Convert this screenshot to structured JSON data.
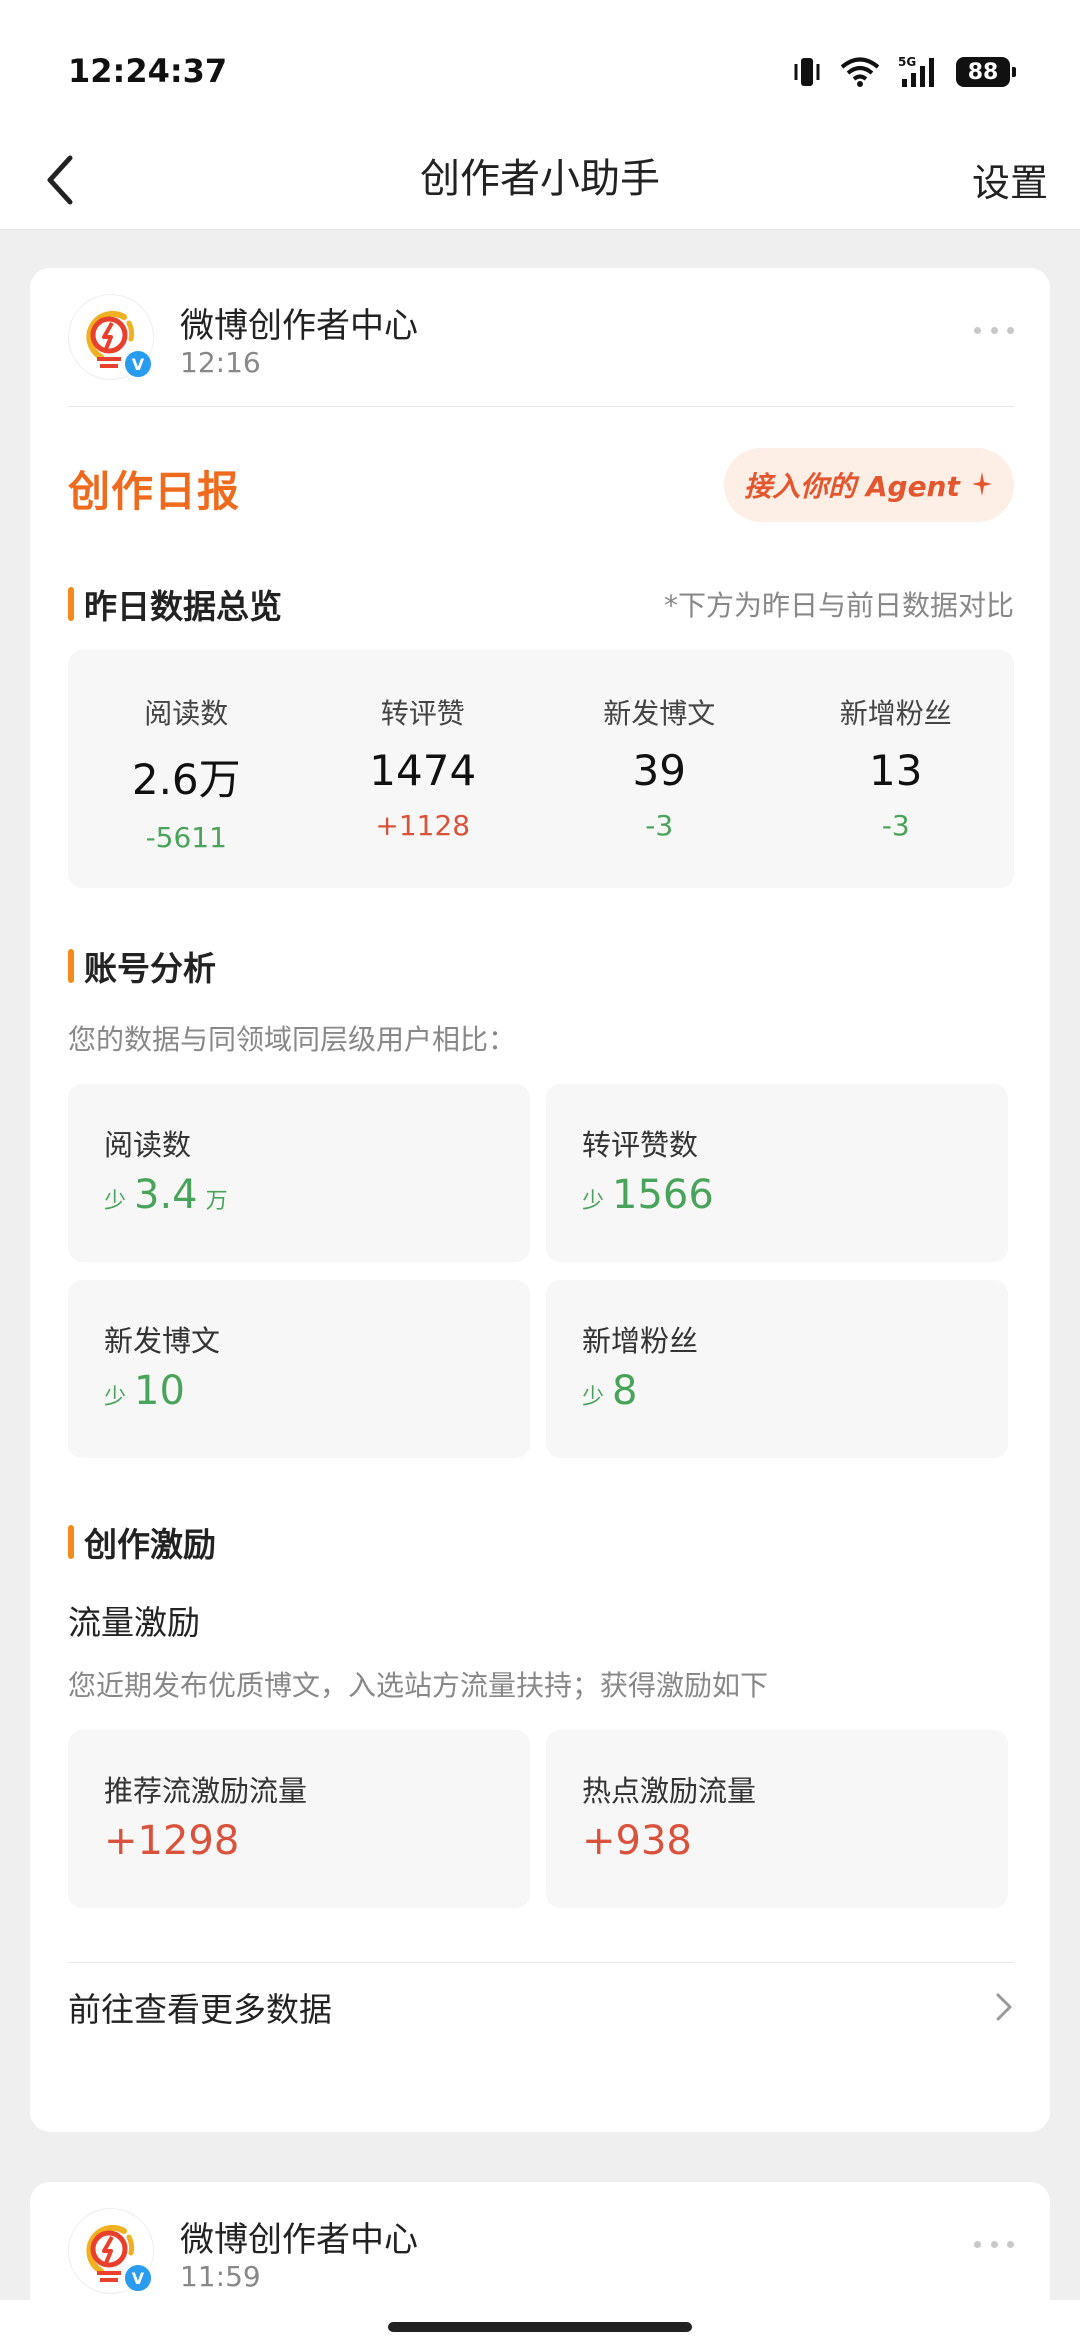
{
  "status_bar": {
    "time": "12:24:37",
    "battery": "88",
    "network": "5G"
  },
  "nav": {
    "title": "创作者小助手",
    "settings": "设置"
  },
  "message": {
    "sender": "微博创作者中心",
    "time": "12:16",
    "badge": "V",
    "report_title": "创作日报",
    "agent_button": "接入你的 Agent",
    "overview": {
      "title": "昨日数据总览",
      "note": "*下方为昨日与前日数据对比",
      "stats": [
        {
          "label": "阅读数",
          "value": "2.6万",
          "delta": "-5611",
          "trend": "down"
        },
        {
          "label": "转评赞",
          "value": "1474",
          "delta": "+1128",
          "trend": "up"
        },
        {
          "label": "新发博文",
          "value": "39",
          "delta": "-3",
          "trend": "down"
        },
        {
          "label": "新增粉丝",
          "value": "13",
          "delta": "-3",
          "trend": "down"
        }
      ]
    },
    "analysis": {
      "title": "账号分析",
      "intro": "您的数据与同领域同层级用户相比：",
      "metrics": [
        {
          "label": "阅读数",
          "prefix": "少",
          "value": "3.4",
          "unit": "万"
        },
        {
          "label": "转评赞数",
          "prefix": "少",
          "value": "1566",
          "unit": ""
        },
        {
          "label": "新发博文",
          "prefix": "少",
          "value": "10",
          "unit": ""
        },
        {
          "label": "新增粉丝",
          "prefix": "少",
          "value": "8",
          "unit": ""
        }
      ]
    },
    "incentive": {
      "title": "创作激励",
      "subtitle": "流量激励",
      "intro": "您近期发布优质博文，入选站方流量扶持；获得激励如下",
      "items": [
        {
          "label": "推荐流激励流量",
          "value": "+1298"
        },
        {
          "label": "热点激励流量",
          "value": "+938"
        }
      ]
    },
    "more_link": "前往查看更多数据"
  },
  "next_message": {
    "sender": "微博创作者中心",
    "time": "11:59"
  },
  "colors": {
    "accent": "#f06a1e",
    "positive": "#d9533c",
    "negative": "#4aa35a",
    "section_bar": "#f28a1c"
  }
}
